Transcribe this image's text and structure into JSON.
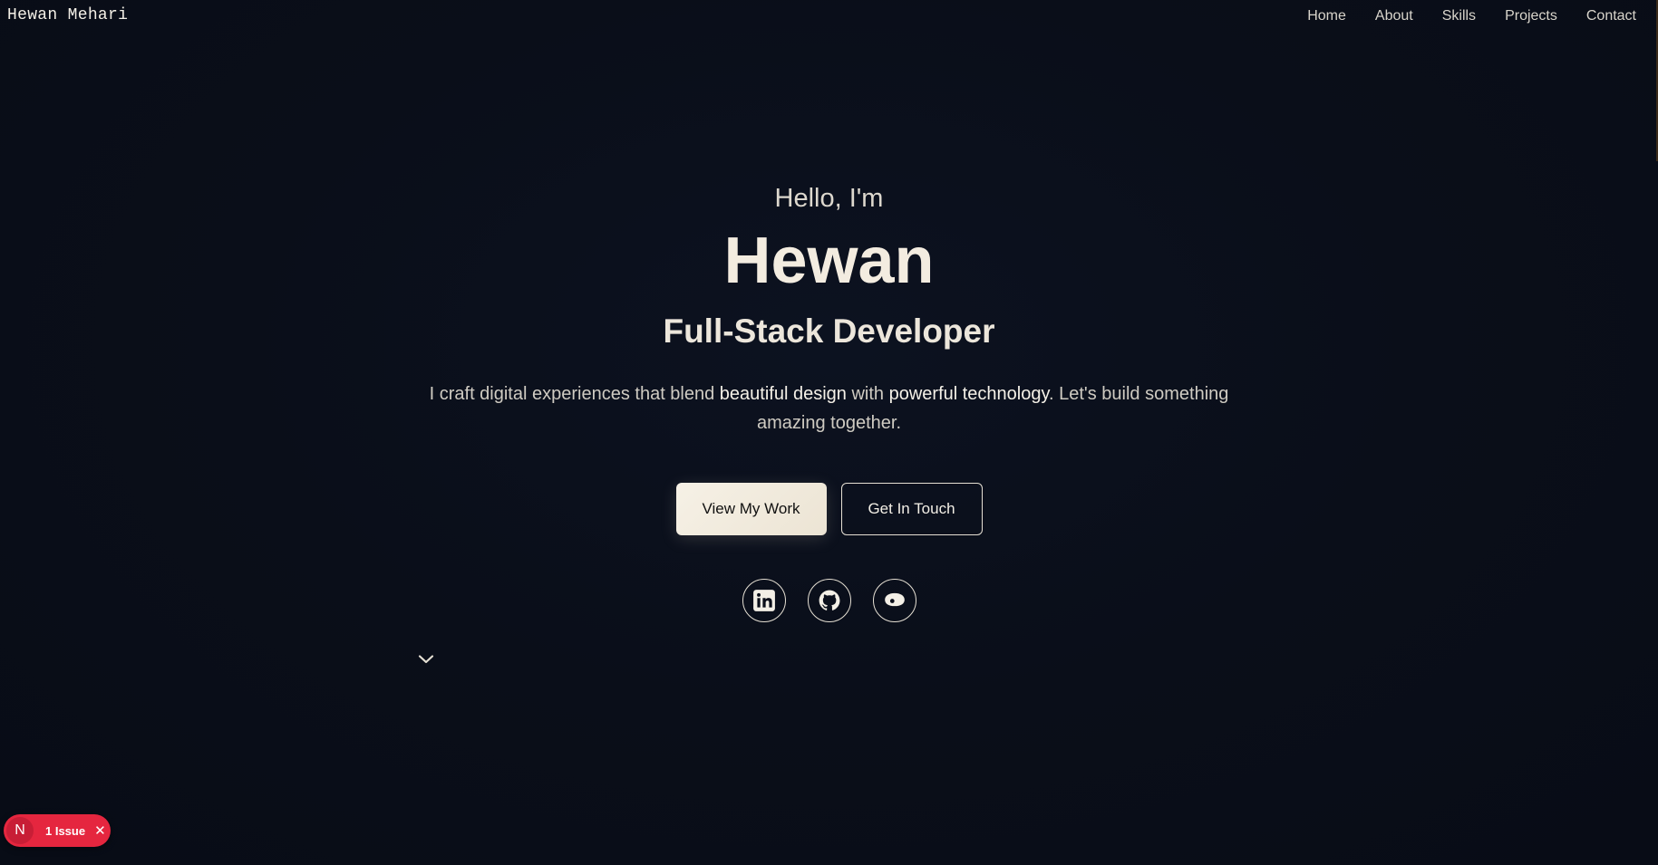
{
  "header": {
    "brand": "Hewan Mehari",
    "nav": [
      "Home",
      "About",
      "Skills",
      "Projects",
      "Contact"
    ]
  },
  "hero": {
    "greeting": "Hello, I'm",
    "name": "Hewan",
    "role": "Full-Stack Developer",
    "tagline": {
      "part1": "I craft digital experiences that blend ",
      "highlight1": "beautiful design",
      "part2": " with ",
      "highlight2": "powerful technology",
      "part3": ". Let's build something amazing together."
    },
    "primary_button": "View My Work",
    "secondary_button": "Get In Touch"
  },
  "social": [
    "linkedin-icon",
    "github-icon",
    "chat-icon"
  ],
  "dev_overlay": {
    "logo_letter": "N",
    "issue_label": "1 Issue",
    "close": "✕"
  },
  "colors": {
    "background": "#0a0e19",
    "text": "#f3efe6",
    "badge": "#e5263f"
  }
}
